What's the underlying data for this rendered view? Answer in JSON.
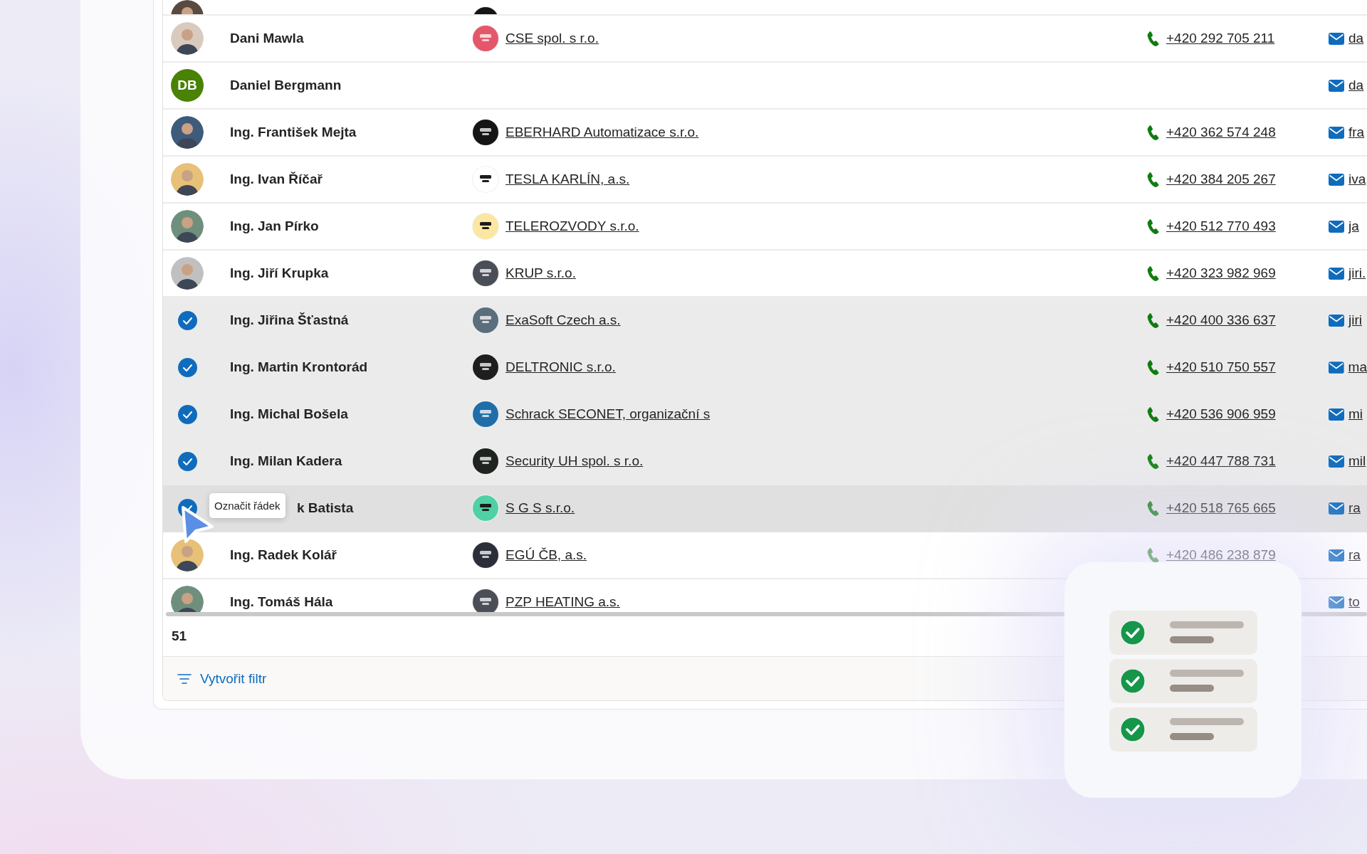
{
  "table": {
    "rows": [
      {
        "kind": "cut",
        "selected": false,
        "hovered": false,
        "avatar": {
          "kind": "photo"
        },
        "company": {
          "color": "#151515"
        }
      },
      {
        "kind": "full",
        "selected": false,
        "hovered": false,
        "avatar": {
          "kind": "photo"
        },
        "name": "Dani Mawla",
        "company": {
          "name": "CSE spol. s r.o.",
          "color": "#e5566a"
        },
        "phone": "+420 292 705 211",
        "email": "da"
      },
      {
        "kind": "full",
        "selected": false,
        "hovered": false,
        "avatar": {
          "kind": "initials",
          "initials": "DB",
          "color": "#498205"
        },
        "name": "Daniel Bergmann",
        "email": "da"
      },
      {
        "kind": "full",
        "selected": false,
        "hovered": false,
        "avatar": {
          "kind": "photo"
        },
        "name": "Ing. František Mejta",
        "company": {
          "name": "EBERHARD Automatizace s.r.o.",
          "color": "#151515"
        },
        "phone": "+420 362 574 248",
        "email": "fra"
      },
      {
        "kind": "full",
        "selected": false,
        "hovered": false,
        "avatar": {
          "kind": "photo"
        },
        "name": "Ing. Ivan Říčař",
        "company": {
          "name": "TESLA KARLÍN, a.s.",
          "color": "#ffffff"
        },
        "phone": "+420 384 205 267",
        "email": "iva"
      },
      {
        "kind": "full",
        "selected": false,
        "hovered": false,
        "avatar": {
          "kind": "photo"
        },
        "name": "Ing. Jan Pírko",
        "company": {
          "name": "TELEROZVODY s.r.o.",
          "color": "#fbe7a1"
        },
        "phone": "+420 512 770 493",
        "email": "ja"
      },
      {
        "kind": "full",
        "selected": false,
        "hovered": false,
        "avatar": {
          "kind": "photo"
        },
        "name": "Ing. Jiří Krupka",
        "company": {
          "name": "KRUP s.r.o.",
          "color": "#4a4e57"
        },
        "phone": "+420 323 982 969",
        "email": "jiri."
      },
      {
        "kind": "full",
        "selected": true,
        "hovered": false,
        "name": "Ing. Jiřina Šťastná",
        "company": {
          "name": "ExaSoft Czech a.s.",
          "color": "#5b6e7c"
        },
        "phone": "+420 400 336 637",
        "email": "jiri"
      },
      {
        "kind": "full",
        "selected": true,
        "hovered": false,
        "name": "Ing. Martin Krontorád",
        "company": {
          "name": "DELTRONIC s.r.o.",
          "color": "#1e1e1e"
        },
        "phone": "+420 510 750 557",
        "email": "ma"
      },
      {
        "kind": "full",
        "selected": true,
        "hovered": false,
        "name": "Ing. Michal Bošela",
        "company": {
          "name": "Schrack SECONET, organizační s",
          "color": "#1f6ea8"
        },
        "phone": "+420 536 906 959",
        "email": "mi"
      },
      {
        "kind": "full",
        "selected": true,
        "hovered": false,
        "name": "Ing. Milan Kadera",
        "company": {
          "name": "Security UH spol. s r.o.",
          "color": "#1f2421"
        },
        "phone": "+420 447 788 731",
        "email": "mil"
      },
      {
        "kind": "full",
        "selected": true,
        "hovered": true,
        "name": "k Batista",
        "tooltip": "Označit řádek",
        "company": {
          "name": "S G S s.r.o.",
          "color": "#4fd1a5"
        },
        "phone": "+420 518 765 665",
        "email": "ra"
      },
      {
        "kind": "full",
        "selected": false,
        "hovered": false,
        "avatar": {
          "kind": "photo"
        },
        "name": "Ing. Radek Kolář",
        "company": {
          "name": "EGÚ ČB, a.s.",
          "color": "#2b2f3a"
        },
        "phone": "+420 486 238 879",
        "email": "ra"
      },
      {
        "kind": "full",
        "selected": false,
        "hovered": false,
        "avatar": {
          "kind": "photo"
        },
        "name": "Ing. Tomáš Hála",
        "company": {
          "name": "PZP HEATING a.s.",
          "color": "#4a4e57"
        },
        "email": "to"
      }
    ]
  },
  "footer": {
    "count": "51"
  },
  "filter_button": {
    "label": "Vytvořit filtr"
  }
}
